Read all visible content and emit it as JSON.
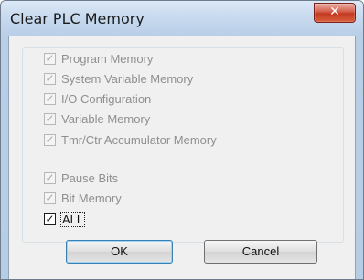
{
  "dialog": {
    "title": "Clear PLC Memory",
    "close_glyph": "✕"
  },
  "options": [
    {
      "label": "Program Memory",
      "checked": true,
      "enabled": false
    },
    {
      "label": "System Variable Memory",
      "checked": true,
      "enabled": false
    },
    {
      "label": "I/O Configuration",
      "checked": true,
      "enabled": false
    },
    {
      "label": "Variable Memory",
      "checked": true,
      "enabled": false
    },
    {
      "label": "Tmr/Ctr Accumulator Memory",
      "checked": true,
      "enabled": false
    },
    {
      "label": "Pause Bits",
      "checked": true,
      "enabled": false
    },
    {
      "label": "Bit Memory",
      "checked": true,
      "enabled": false
    },
    {
      "label": "ALL",
      "checked": true,
      "enabled": true
    }
  ],
  "buttons": {
    "ok_label": "OK",
    "cancel_label": "Cancel"
  }
}
